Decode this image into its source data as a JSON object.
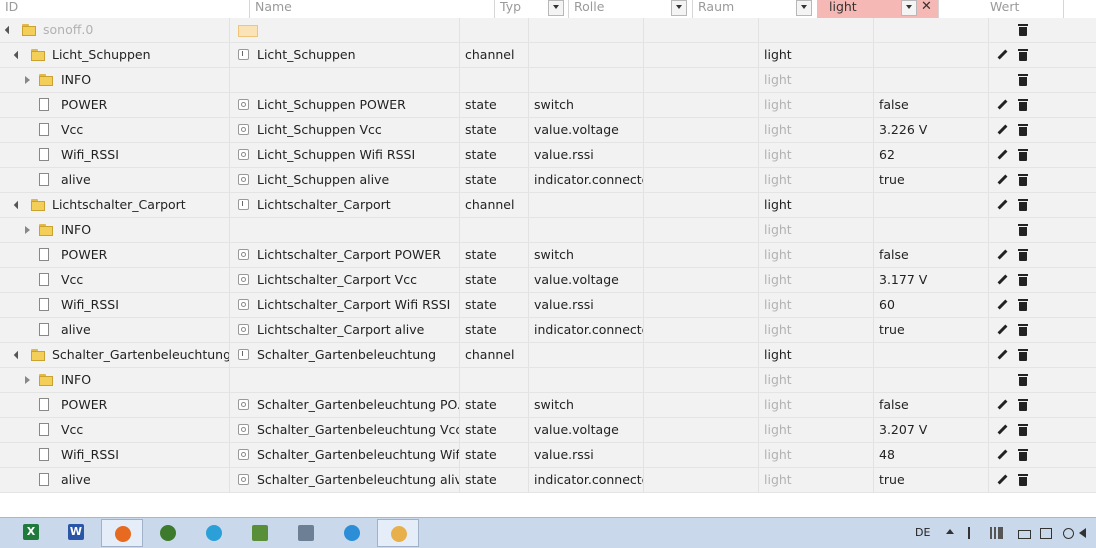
{
  "columns": {
    "id": "ID",
    "name": "Name",
    "type": "Typ",
    "role": "Rolle",
    "room": "Raum",
    "room_filter": "light",
    "value": "Wert"
  },
  "root": {
    "id": "sonoff.0"
  },
  "rows": [
    {
      "id": "Licht_Schuppen",
      "name": "Licht_Schuppen",
      "type": "channel",
      "role": "",
      "room": "light",
      "value": ""
    },
    {
      "id": "INFO",
      "name": "",
      "type": "",
      "role": "",
      "room": "light",
      "value": ""
    },
    {
      "id": "POWER",
      "name": "Licht_Schuppen POWER",
      "type": "state",
      "role": "switch",
      "room": "light",
      "value": "false"
    },
    {
      "id": "Vcc",
      "name": "Licht_Schuppen Vcc",
      "type": "state",
      "role": "value.voltage",
      "room": "light",
      "value": "3.226 V"
    },
    {
      "id": "Wifi_RSSI",
      "name": "Licht_Schuppen Wifi RSSI",
      "type": "state",
      "role": "value.rssi",
      "room": "light",
      "value": "62"
    },
    {
      "id": "alive",
      "name": "Licht_Schuppen alive",
      "type": "state",
      "role": "indicator.connected",
      "room": "light",
      "value": "true"
    },
    {
      "id": "Lichtschalter_Carport",
      "name": "Lichtschalter_Carport",
      "type": "channel",
      "role": "",
      "room": "light",
      "value": ""
    },
    {
      "id": "INFO",
      "name": "",
      "type": "",
      "role": "",
      "room": "light",
      "value": ""
    },
    {
      "id": "POWER",
      "name": "Lichtschalter_Carport POWER",
      "type": "state",
      "role": "switch",
      "room": "light",
      "value": "false"
    },
    {
      "id": "Vcc",
      "name": "Lichtschalter_Carport Vcc",
      "type": "state",
      "role": "value.voltage",
      "room": "light",
      "value": "3.177 V"
    },
    {
      "id": "Wifi_RSSI",
      "name": "Lichtschalter_Carport Wifi RSSI",
      "type": "state",
      "role": "value.rssi",
      "room": "light",
      "value": "60"
    },
    {
      "id": "alive",
      "name": "Lichtschalter_Carport alive",
      "type": "state",
      "role": "indicator.connected",
      "room": "light",
      "value": "true"
    },
    {
      "id": "Schalter_Gartenbeleuchtung",
      "name": "Schalter_Gartenbeleuchtung",
      "type": "channel",
      "role": "",
      "room": "light",
      "value": ""
    },
    {
      "id": "INFO",
      "name": "",
      "type": "",
      "role": "",
      "room": "light",
      "value": ""
    },
    {
      "id": "POWER",
      "name": "Schalter_Gartenbeleuchtung PO...",
      "type": "state",
      "role": "switch",
      "room": "light",
      "value": "false"
    },
    {
      "id": "Vcc",
      "name": "Schalter_Gartenbeleuchtung Vcc",
      "type": "state",
      "role": "value.voltage",
      "room": "light",
      "value": "3.207 V"
    },
    {
      "id": "Wifi_RSSI",
      "name": "Schalter_Gartenbeleuchtung Wifi ...",
      "type": "state",
      "role": "value.rssi",
      "room": "light",
      "value": "48"
    },
    {
      "id": "alive",
      "name": "Schalter_Gartenbeleuchtung alive",
      "type": "state",
      "role": "indicator.connected",
      "room": "light",
      "value": "true"
    }
  ],
  "taskbar": {
    "language": "DE",
    "apps": [
      "excel-icon",
      "word-icon",
      "firefox-icon",
      "globe-icon",
      "wifi-app-icon",
      "network-manager-icon",
      "remote-desktop-icon",
      "internet-explorer-icon",
      "paint-icon"
    ]
  }
}
